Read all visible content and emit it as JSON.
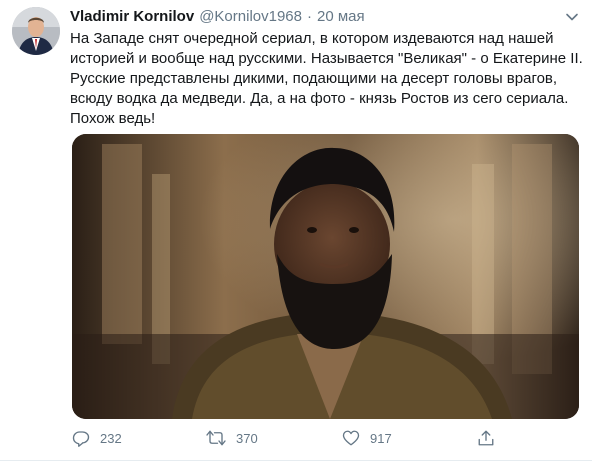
{
  "tweet": {
    "author_name": "Vladimir Kornilov",
    "handle": "@Kornilov1968",
    "separator": "·",
    "date": "20 мая",
    "text_lines": [
      "На Западе снят очередной сериал, в котором издеваются над нашей",
      "историей и вообще над русскими. Называется \"Великая\" - о Екатерине II.",
      "Русские представлены дикими, подающими на десерт головы врагов,",
      "всюду водка да медведи. Да, а на фото - князь Ростов из сего сериала.",
      "Похож ведь!"
    ],
    "counts": {
      "replies": "232",
      "retweets": "370",
      "likes": "917"
    }
  },
  "icons": {
    "caret": "chevron-down-icon",
    "reply": "reply-icon",
    "retweet": "retweet-icon",
    "like": "heart-icon",
    "share": "share-icon"
  },
  "colors": {
    "text": "#14171a",
    "secondary": "#657786",
    "divider": "#e6ecf0"
  }
}
